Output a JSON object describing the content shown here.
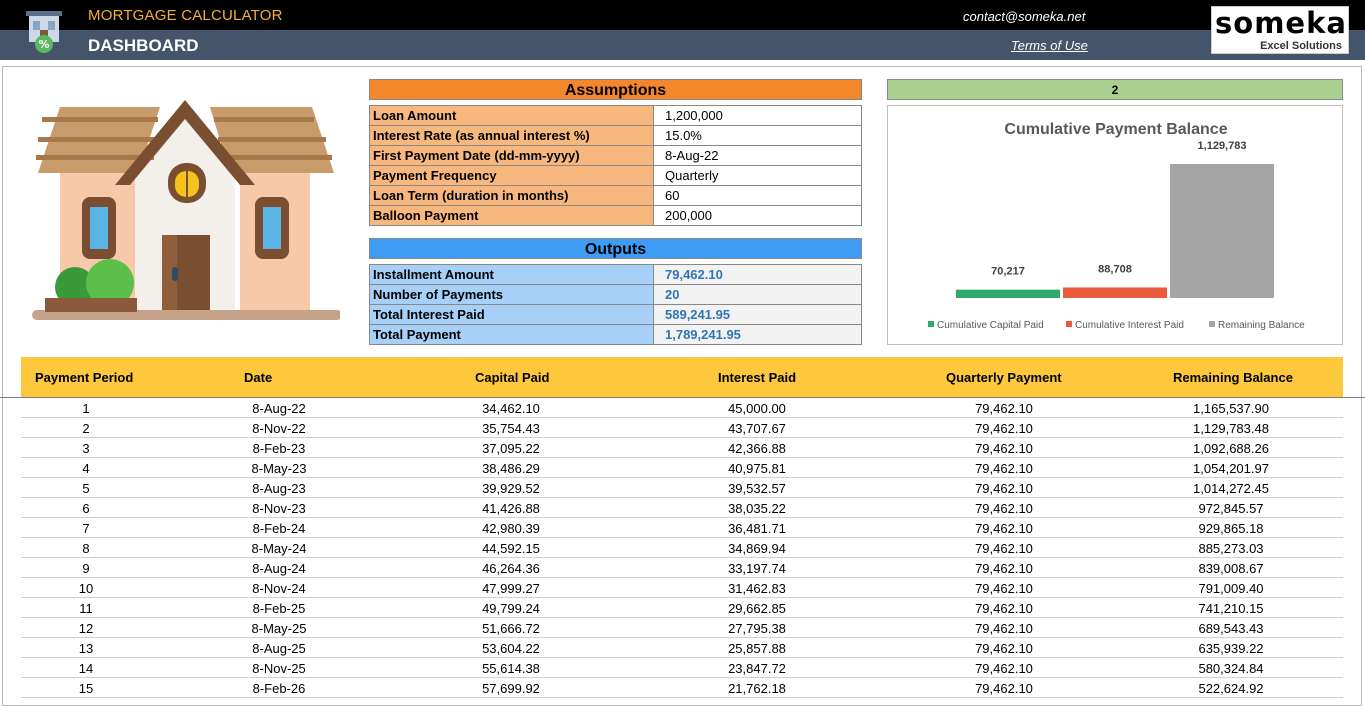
{
  "header": {
    "app_title": "MORTGAGE CALCULATOR",
    "page_title": "DASHBOARD",
    "contact": "contact@someka.net",
    "terms_link": "Terms of Use",
    "logo_name": "someka",
    "logo_sub": "Excel Solutions",
    "icon": "house-percent-icon"
  },
  "colors": {
    "header_black": "#000000",
    "header_slate": "#44546a",
    "title_gold": "#f4b030",
    "assumptions_orange": "#f4862b",
    "outputs_blue": "#3f9cf5",
    "output_value_blue": "#2e75b6",
    "table_header_yellow": "#fdc83c",
    "capital_green": "#2eaa6b",
    "interest_red": "#ea5a3c",
    "balance_gray": "#a5a5a5"
  },
  "assumptions": {
    "title": "Assumptions",
    "rows": [
      {
        "label": "Loan Amount",
        "value": "1,200,000"
      },
      {
        "label": "Interest Rate (as annual interest %)",
        "value": "15.0%"
      },
      {
        "label": "First Payment Date (dd-mm-yyyy)",
        "value": "8-Aug-22"
      },
      {
        "label": "Payment Frequency",
        "value": "Quarterly"
      },
      {
        "label": "Loan Term (duration in months)",
        "value": "60"
      },
      {
        "label": "Balloon Payment",
        "value": "200,000"
      }
    ]
  },
  "outputs": {
    "title": "Outputs",
    "rows": [
      {
        "label": "Installment Amount",
        "value": "79,462.10"
      },
      {
        "label": "Number of Payments",
        "value": "20"
      },
      {
        "label": "Total Interest Paid",
        "value": "589,241.95"
      },
      {
        "label": "Total Payment",
        "value": "1,789,241.95"
      }
    ]
  },
  "chart_tag": "2",
  "chart_data": {
    "type": "bar",
    "title": "Cumulative Payment Balance",
    "series": [
      {
        "name": "Cumulative Capital Paid",
        "value": 70217,
        "label": "70,217",
        "color": "#2eaa6b"
      },
      {
        "name": "Cumulative Interest Paid",
        "value": 88708,
        "label": "88,708",
        "color": "#ea5a3c"
      },
      {
        "name": "Remaining Balance",
        "value": 1129783,
        "label": "1,129,783",
        "color": "#a5a5a5"
      }
    ],
    "legend": "bottom",
    "grid": false
  },
  "schedule": {
    "columns": [
      "Payment Period",
      "Date",
      "Capital Paid",
      "Interest Paid",
      "Quarterly Payment",
      "Remaining Balance"
    ],
    "rows": [
      [
        "1",
        "8-Aug-22",
        "34,462.10",
        "45,000.00",
        "79,462.10",
        "1,165,537.90"
      ],
      [
        "2",
        "8-Nov-22",
        "35,754.43",
        "43,707.67",
        "79,462.10",
        "1,129,783.48"
      ],
      [
        "3",
        "8-Feb-23",
        "37,095.22",
        "42,366.88",
        "79,462.10",
        "1,092,688.26"
      ],
      [
        "4",
        "8-May-23",
        "38,486.29",
        "40,975.81",
        "79,462.10",
        "1,054,201.97"
      ],
      [
        "5",
        "8-Aug-23",
        "39,929.52",
        "39,532.57",
        "79,462.10",
        "1,014,272.45"
      ],
      [
        "6",
        "8-Nov-23",
        "41,426.88",
        "38,035.22",
        "79,462.10",
        "972,845.57"
      ],
      [
        "7",
        "8-Feb-24",
        "42,980.39",
        "36,481.71",
        "79,462.10",
        "929,865.18"
      ],
      [
        "8",
        "8-May-24",
        "44,592.15",
        "34,869.94",
        "79,462.10",
        "885,273.03"
      ],
      [
        "9",
        "8-Aug-24",
        "46,264.36",
        "33,197.74",
        "79,462.10",
        "839,008.67"
      ],
      [
        "10",
        "8-Nov-24",
        "47,999.27",
        "31,462.83",
        "79,462.10",
        "791,009.40"
      ],
      [
        "11",
        "8-Feb-25",
        "49,799.24",
        "29,662.85",
        "79,462.10",
        "741,210.15"
      ],
      [
        "12",
        "8-May-25",
        "51,666.72",
        "27,795.38",
        "79,462.10",
        "689,543.43"
      ],
      [
        "13",
        "8-Aug-25",
        "53,604.22",
        "25,857.88",
        "79,462.10",
        "635,939.22"
      ],
      [
        "14",
        "8-Nov-25",
        "55,614.38",
        "23,847.72",
        "79,462.10",
        "580,324.84"
      ],
      [
        "15",
        "8-Feb-26",
        "57,699.92",
        "21,762.18",
        "79,462.10",
        "522,624.92"
      ]
    ]
  }
}
